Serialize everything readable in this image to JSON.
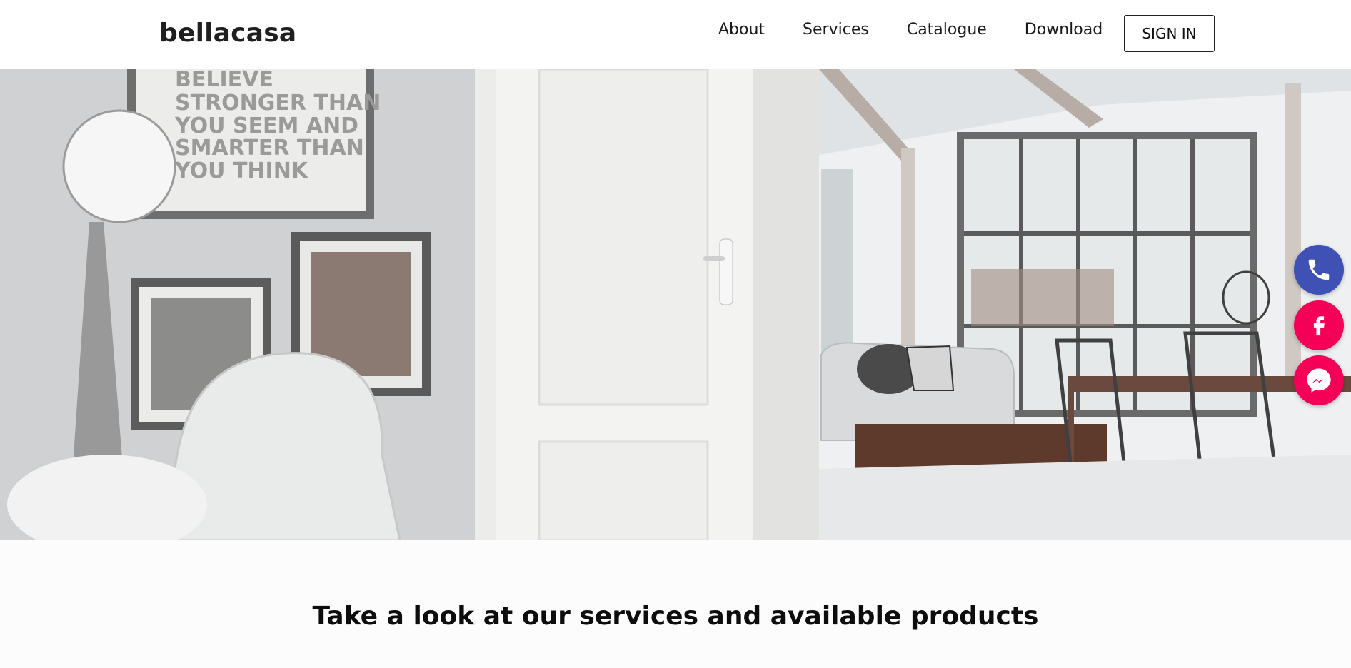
{
  "header": {
    "brand": "bellacasa",
    "nav": [
      {
        "label": "About"
      },
      {
        "label": "Services"
      },
      {
        "label": "Catalogue"
      },
      {
        "label": "Download"
      }
    ],
    "signin_label": "SIGN IN"
  },
  "hero": {
    "poster_lines": [
      "BELIEVE",
      "STRONGER THAN",
      "YOU SEEM AND",
      "SMARTER THAN",
      "YOU THINK"
    ]
  },
  "floating_contacts": [
    {
      "name": "phone",
      "icon": "phone-icon",
      "color": "#3f51b5"
    },
    {
      "name": "facebook",
      "icon": "facebook-icon",
      "color": "#f50057"
    },
    {
      "name": "messenger",
      "icon": "messenger-icon",
      "color": "#f50057"
    }
  ],
  "section": {
    "title": "Take a look at our services and available products"
  }
}
